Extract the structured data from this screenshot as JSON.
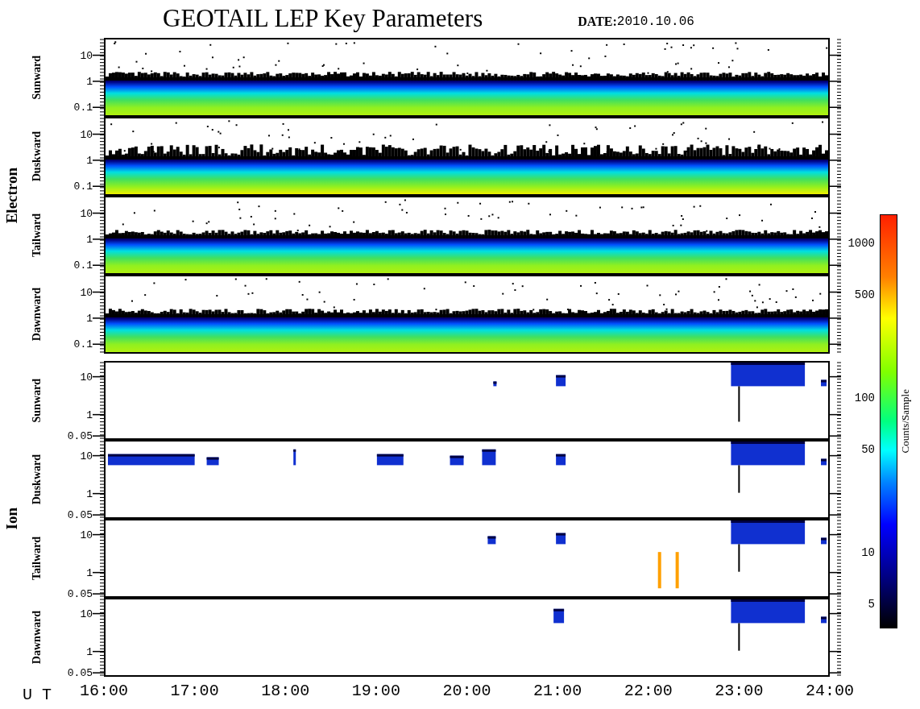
{
  "title": "GEOTAIL LEP Key Parameters",
  "date": {
    "label": "DATE:",
    "value": "2010.10.06"
  },
  "sections": [
    {
      "name": "Electron",
      "kind": "electron",
      "panels": [
        {
          "name": "Sunward",
          "yticks": [
            "10",
            "1",
            "0.1"
          ]
        },
        {
          "name": "Duskward",
          "yticks": [
            "10",
            "1",
            "0.1"
          ]
        },
        {
          "name": "Tailward",
          "yticks": [
            "10",
            "1",
            "0.1"
          ]
        },
        {
          "name": "Dawnward",
          "yticks": [
            "10",
            "1",
            "0.1"
          ]
        }
      ]
    },
    {
      "name": "Ion",
      "kind": "ion",
      "panels": [
        {
          "name": "Sunward",
          "yticks": [
            "10",
            "1",
            "0.05"
          ]
        },
        {
          "name": "Duskward",
          "yticks": [
            "10",
            "1",
            "0.05"
          ]
        },
        {
          "name": "Tailward",
          "yticks": [
            "10",
            "1",
            "0.05"
          ]
        },
        {
          "name": "Dawnward",
          "yticks": [
            "10",
            "1",
            "0.05"
          ]
        }
      ]
    }
  ],
  "x_axis": {
    "label": "U T",
    "ticks": [
      "16:00",
      "17:00",
      "18:00",
      "19:00",
      "20:00",
      "21:00",
      "22:00",
      "23:00",
      "24:00"
    ]
  },
  "colorbar": {
    "title": "Counts/Sample",
    "ticks": [
      "1000",
      "500",
      "100",
      "50",
      "10",
      "5"
    ]
  }
}
